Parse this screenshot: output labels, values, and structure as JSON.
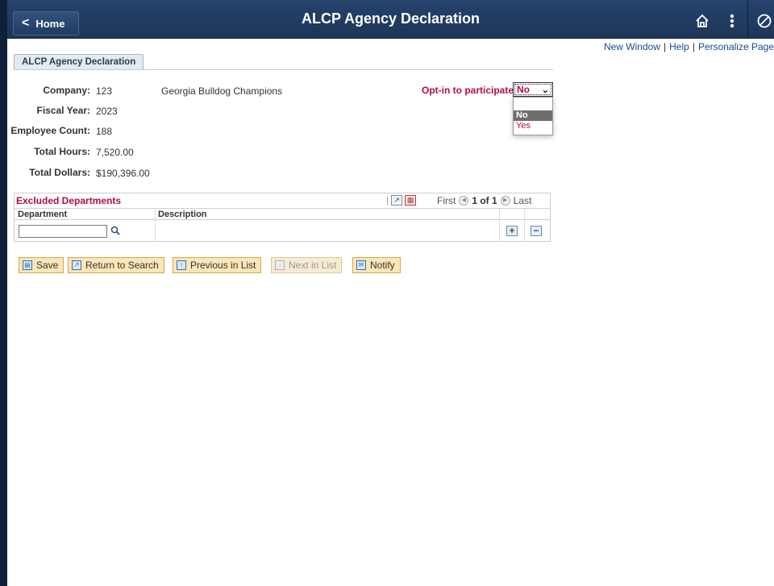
{
  "header": {
    "home_label": "Home",
    "title": "ALCP Agency Declaration",
    "icons": [
      "home-icon",
      "more-vertical-icon",
      "nav-bar-icon"
    ]
  },
  "links": {
    "new_window": "New Window",
    "help": "Help",
    "personalize": "Personalize Page"
  },
  "tab": {
    "label": "ALCP Agency Declaration"
  },
  "fields": {
    "company_label": "Company:",
    "company_value": "123",
    "company_name": "Georgia Bulldog Champions",
    "fiscal_year_label": "Fiscal Year:",
    "fiscal_year_value": "2023",
    "employee_count_label": "Employee Count:",
    "employee_count_value": "188",
    "total_hours_label": "Total Hours:",
    "total_hours_value": "7,520.00",
    "total_dollars_label": "Total Dollars:",
    "total_dollars_value": "$190,396.00"
  },
  "optin": {
    "label": "Opt-in to participate:",
    "selected": "No",
    "options": [
      "No",
      "Yes"
    ]
  },
  "grid": {
    "title": "Excluded Departments",
    "nav_first": "First",
    "nav_count": "1 of 1",
    "nav_last": "Last",
    "col_department": "Department",
    "col_description": "Description",
    "department_value": ""
  },
  "buttons": {
    "save": "Save",
    "return_to_search": "Return to Search",
    "previous_in_list": "Previous in List",
    "next_in_list": "Next in List",
    "notify": "Notify"
  },
  "colors": {
    "header_bg": "#1d3558",
    "accent_red": "#b50d3c",
    "button_bg": "#fae6b7"
  }
}
